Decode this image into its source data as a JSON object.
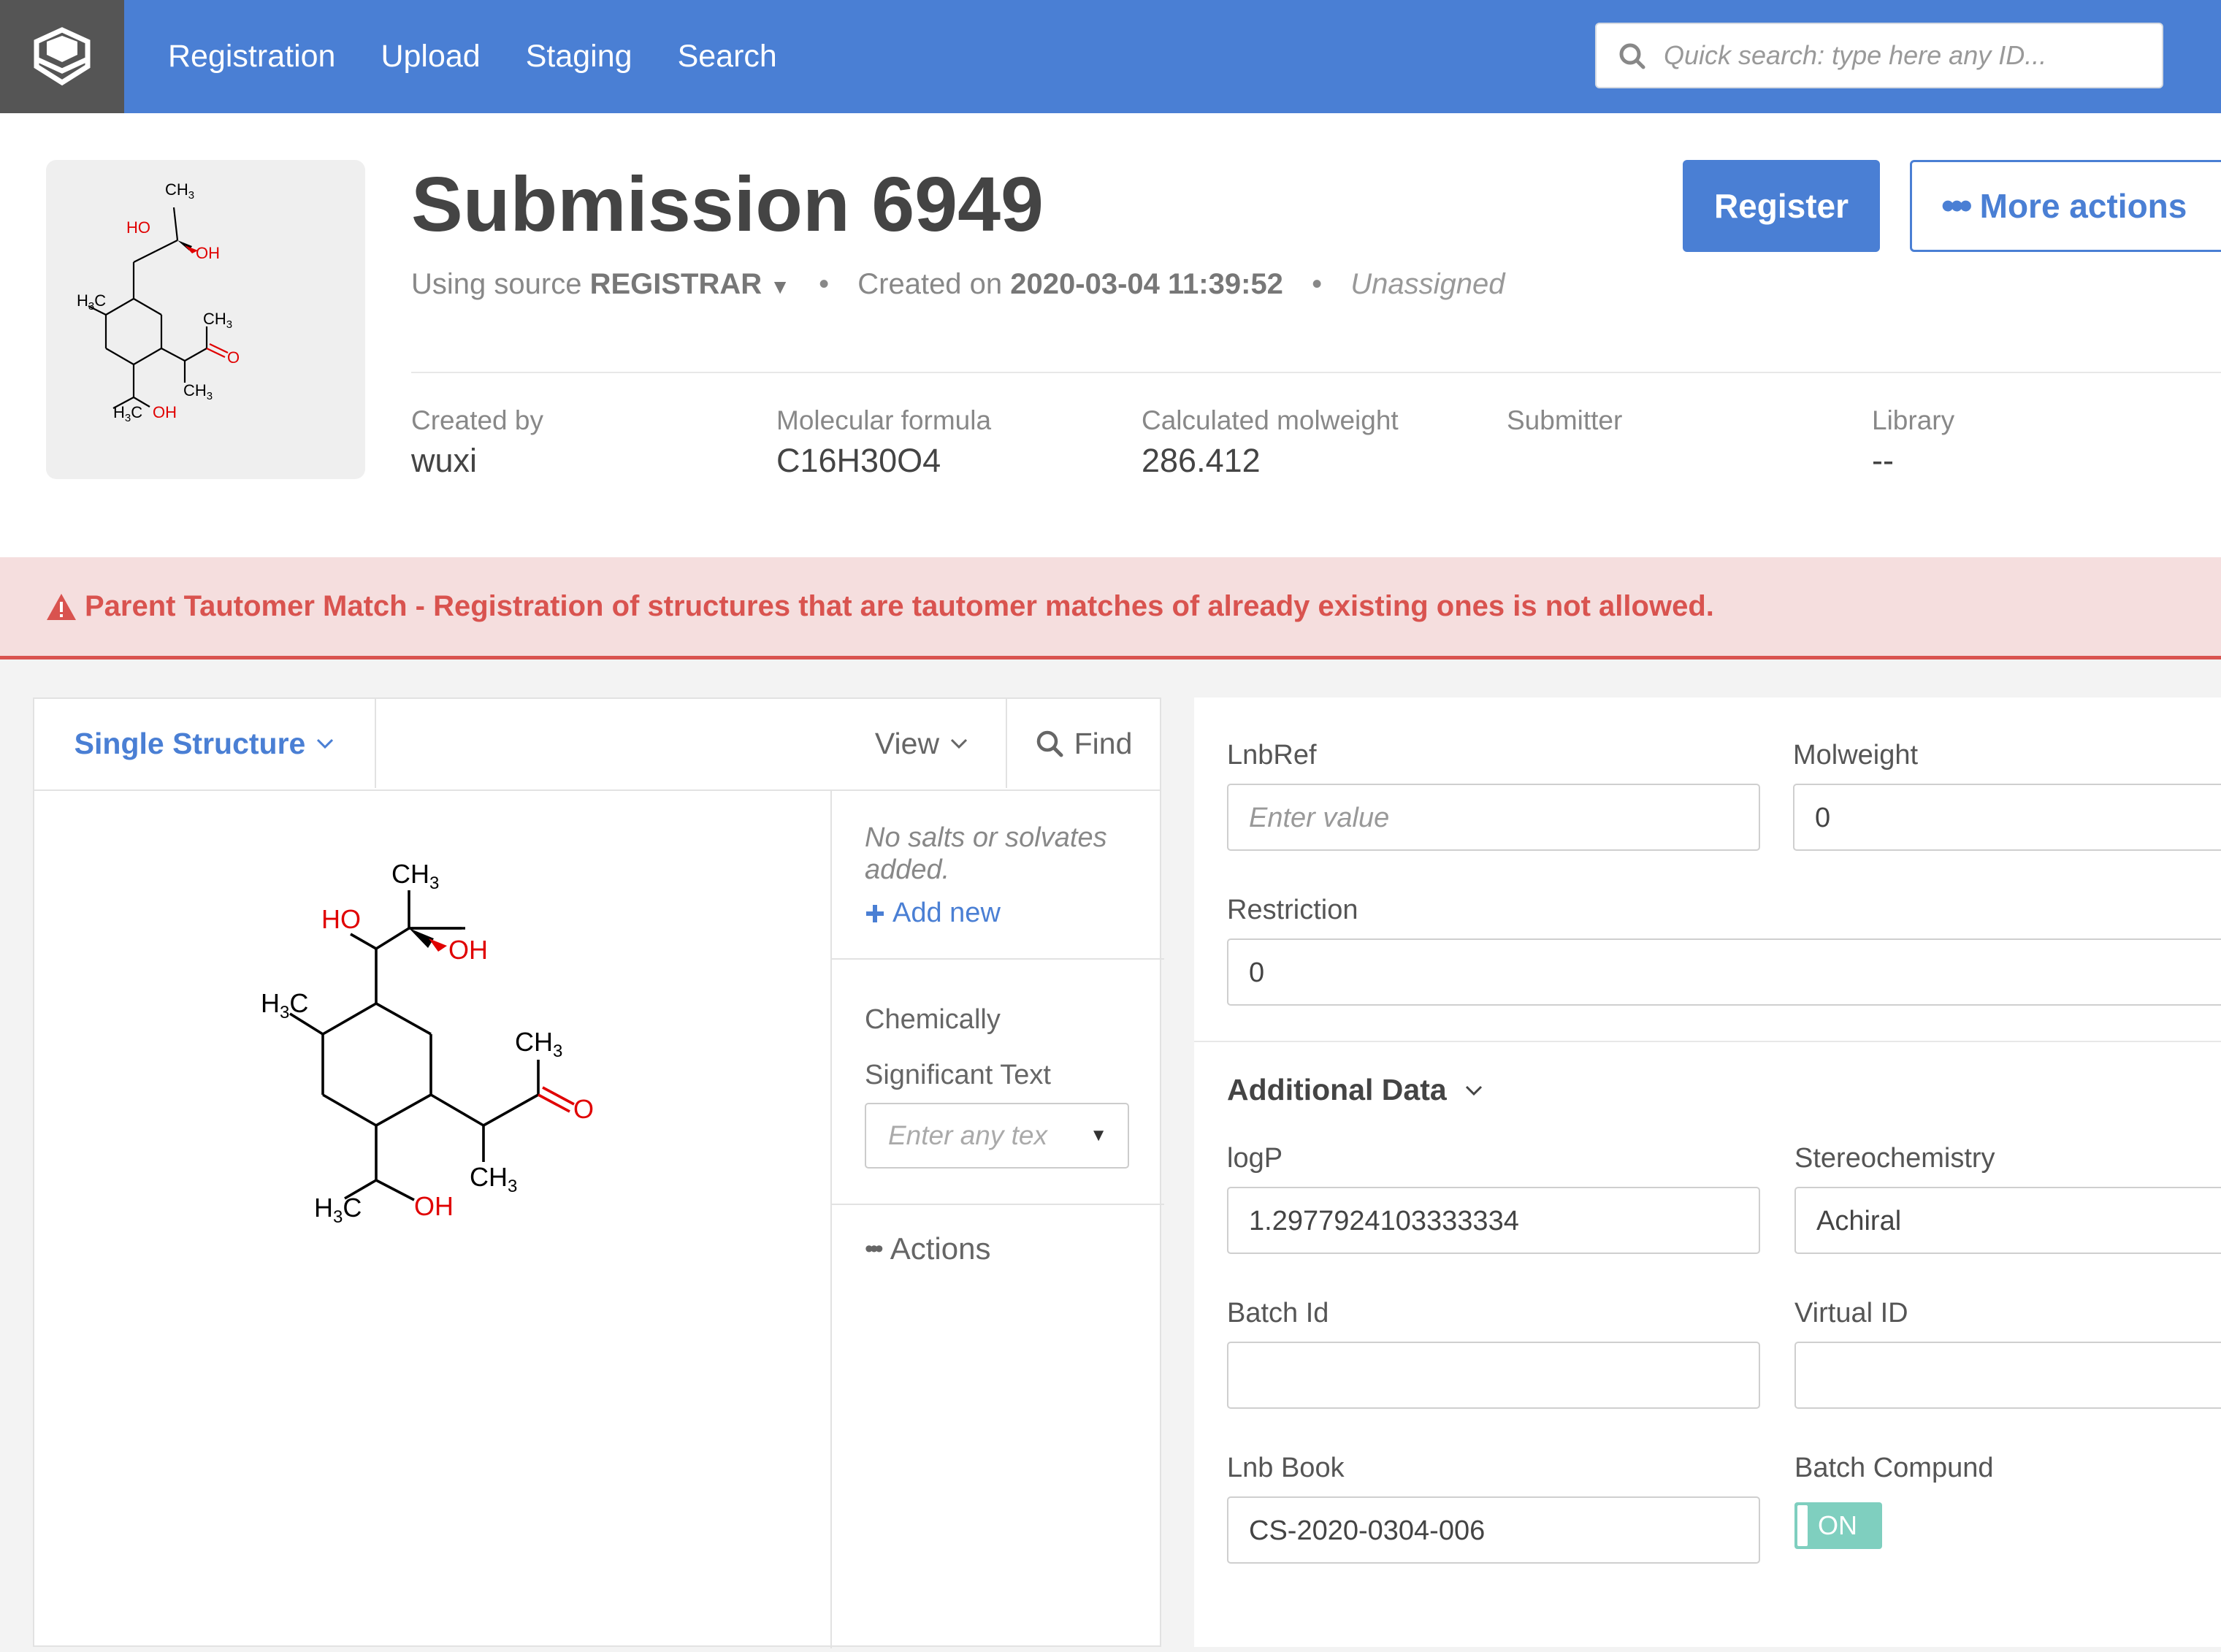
{
  "nav": {
    "items": [
      "Registration",
      "Upload",
      "Staging",
      "Search"
    ],
    "search_placeholder": "Quick search: type here any ID..."
  },
  "submission": {
    "title": "Submission 6949",
    "using_source_label": "Using source",
    "source": "REGISTRAR",
    "created_on_label": "Created on",
    "created_on": "2020-03-04 11:39:52",
    "assignment": "Unassigned",
    "register_label": "Register",
    "more_actions_label": "More actions",
    "properties": [
      {
        "label": "Created by",
        "value": "wuxi"
      },
      {
        "label": "Molecular formula",
        "value": "C16H30O4"
      },
      {
        "label": "Calculated molweight",
        "value": "286.412"
      },
      {
        "label": "Submitter",
        "value": ""
      },
      {
        "label": "Library",
        "value": "--"
      }
    ]
  },
  "alert": {
    "message": "Parent Tautomer Match - Registration of structures that are tautomer matches of already existing ones is not allowed."
  },
  "structure_panel": {
    "mode_label": "Single Structure",
    "view_label": "View",
    "find_label": "Find",
    "salts_text": "No salts or solvates added.",
    "add_new_label": "Add new",
    "cst_label_line1": "Chemically",
    "cst_label_line2": "Significant Text",
    "cst_placeholder": "Enter any tex",
    "actions_label": "Actions"
  },
  "molecule": {
    "labels": {
      "ch3": "CH",
      "sub3": "3",
      "h3": "H",
      "c": "C",
      "ho": "HO",
      "oh": "OH",
      "o": "O"
    },
    "colors": {
      "heteroatom": "#e00000",
      "bond": "#000000"
    }
  },
  "form": {
    "lnbref_label": "LnbRef",
    "lnbref_placeholder": "Enter value",
    "lnbref_value": "",
    "molweight_label": "Molweight",
    "molweight_value": "0",
    "restriction_label": "Restriction",
    "restriction_value": "0",
    "additional_data_label": "Additional Data",
    "logp_label": "logP",
    "logp_value": "1.2977924103333334",
    "stereo_label": "Stereochemistry",
    "stereo_value": "Achiral",
    "batch_id_label": "Batch Id",
    "batch_id_value": "",
    "virtual_id_label": "Virtual ID",
    "virtual_id_value": "",
    "lnb_book_label": "Lnb Book",
    "lnb_book_value": "CS-2020-0304-006",
    "batch_compound_label": "Batch Compund",
    "batch_compound_toggle": "ON"
  },
  "colors": {
    "primary": "#4a7fd4",
    "danger": "#d9534f",
    "toggle_on": "#7fcfbf"
  }
}
